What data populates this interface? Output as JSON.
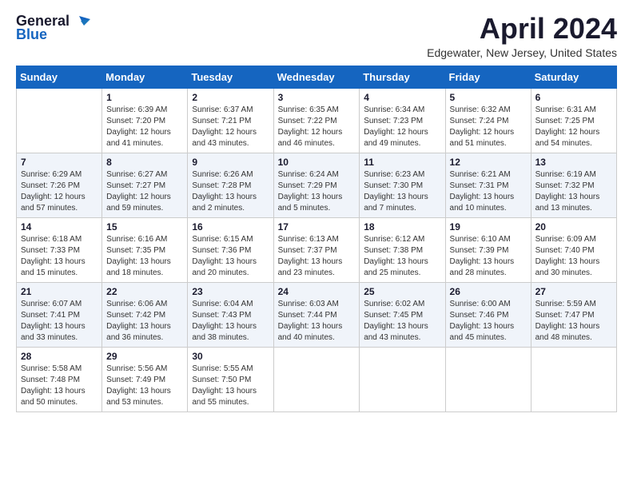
{
  "logo": {
    "general": "General",
    "blue": "Blue"
  },
  "title": "April 2024",
  "location": "Edgewater, New Jersey, United States",
  "days_of_week": [
    "Sunday",
    "Monday",
    "Tuesday",
    "Wednesday",
    "Thursday",
    "Friday",
    "Saturday"
  ],
  "weeks": [
    [
      {
        "day": "",
        "sunrise": "",
        "sunset": "",
        "daylight": ""
      },
      {
        "day": "1",
        "sunrise": "Sunrise: 6:39 AM",
        "sunset": "Sunset: 7:20 PM",
        "daylight": "Daylight: 12 hours and 41 minutes."
      },
      {
        "day": "2",
        "sunrise": "Sunrise: 6:37 AM",
        "sunset": "Sunset: 7:21 PM",
        "daylight": "Daylight: 12 hours and 43 minutes."
      },
      {
        "day": "3",
        "sunrise": "Sunrise: 6:35 AM",
        "sunset": "Sunset: 7:22 PM",
        "daylight": "Daylight: 12 hours and 46 minutes."
      },
      {
        "day": "4",
        "sunrise": "Sunrise: 6:34 AM",
        "sunset": "Sunset: 7:23 PM",
        "daylight": "Daylight: 12 hours and 49 minutes."
      },
      {
        "day": "5",
        "sunrise": "Sunrise: 6:32 AM",
        "sunset": "Sunset: 7:24 PM",
        "daylight": "Daylight: 12 hours and 51 minutes."
      },
      {
        "day": "6",
        "sunrise": "Sunrise: 6:31 AM",
        "sunset": "Sunset: 7:25 PM",
        "daylight": "Daylight: 12 hours and 54 minutes."
      }
    ],
    [
      {
        "day": "7",
        "sunrise": "Sunrise: 6:29 AM",
        "sunset": "Sunset: 7:26 PM",
        "daylight": "Daylight: 12 hours and 57 minutes."
      },
      {
        "day": "8",
        "sunrise": "Sunrise: 6:27 AM",
        "sunset": "Sunset: 7:27 PM",
        "daylight": "Daylight: 12 hours and 59 minutes."
      },
      {
        "day": "9",
        "sunrise": "Sunrise: 6:26 AM",
        "sunset": "Sunset: 7:28 PM",
        "daylight": "Daylight: 13 hours and 2 minutes."
      },
      {
        "day": "10",
        "sunrise": "Sunrise: 6:24 AM",
        "sunset": "Sunset: 7:29 PM",
        "daylight": "Daylight: 13 hours and 5 minutes."
      },
      {
        "day": "11",
        "sunrise": "Sunrise: 6:23 AM",
        "sunset": "Sunset: 7:30 PM",
        "daylight": "Daylight: 13 hours and 7 minutes."
      },
      {
        "day": "12",
        "sunrise": "Sunrise: 6:21 AM",
        "sunset": "Sunset: 7:31 PM",
        "daylight": "Daylight: 13 hours and 10 minutes."
      },
      {
        "day": "13",
        "sunrise": "Sunrise: 6:19 AM",
        "sunset": "Sunset: 7:32 PM",
        "daylight": "Daylight: 13 hours and 13 minutes."
      }
    ],
    [
      {
        "day": "14",
        "sunrise": "Sunrise: 6:18 AM",
        "sunset": "Sunset: 7:33 PM",
        "daylight": "Daylight: 13 hours and 15 minutes."
      },
      {
        "day": "15",
        "sunrise": "Sunrise: 6:16 AM",
        "sunset": "Sunset: 7:35 PM",
        "daylight": "Daylight: 13 hours and 18 minutes."
      },
      {
        "day": "16",
        "sunrise": "Sunrise: 6:15 AM",
        "sunset": "Sunset: 7:36 PM",
        "daylight": "Daylight: 13 hours and 20 minutes."
      },
      {
        "day": "17",
        "sunrise": "Sunrise: 6:13 AM",
        "sunset": "Sunset: 7:37 PM",
        "daylight": "Daylight: 13 hours and 23 minutes."
      },
      {
        "day": "18",
        "sunrise": "Sunrise: 6:12 AM",
        "sunset": "Sunset: 7:38 PM",
        "daylight": "Daylight: 13 hours and 25 minutes."
      },
      {
        "day": "19",
        "sunrise": "Sunrise: 6:10 AM",
        "sunset": "Sunset: 7:39 PM",
        "daylight": "Daylight: 13 hours and 28 minutes."
      },
      {
        "day": "20",
        "sunrise": "Sunrise: 6:09 AM",
        "sunset": "Sunset: 7:40 PM",
        "daylight": "Daylight: 13 hours and 30 minutes."
      }
    ],
    [
      {
        "day": "21",
        "sunrise": "Sunrise: 6:07 AM",
        "sunset": "Sunset: 7:41 PM",
        "daylight": "Daylight: 13 hours and 33 minutes."
      },
      {
        "day": "22",
        "sunrise": "Sunrise: 6:06 AM",
        "sunset": "Sunset: 7:42 PM",
        "daylight": "Daylight: 13 hours and 36 minutes."
      },
      {
        "day": "23",
        "sunrise": "Sunrise: 6:04 AM",
        "sunset": "Sunset: 7:43 PM",
        "daylight": "Daylight: 13 hours and 38 minutes."
      },
      {
        "day": "24",
        "sunrise": "Sunrise: 6:03 AM",
        "sunset": "Sunset: 7:44 PM",
        "daylight": "Daylight: 13 hours and 40 minutes."
      },
      {
        "day": "25",
        "sunrise": "Sunrise: 6:02 AM",
        "sunset": "Sunset: 7:45 PM",
        "daylight": "Daylight: 13 hours and 43 minutes."
      },
      {
        "day": "26",
        "sunrise": "Sunrise: 6:00 AM",
        "sunset": "Sunset: 7:46 PM",
        "daylight": "Daylight: 13 hours and 45 minutes."
      },
      {
        "day": "27",
        "sunrise": "Sunrise: 5:59 AM",
        "sunset": "Sunset: 7:47 PM",
        "daylight": "Daylight: 13 hours and 48 minutes."
      }
    ],
    [
      {
        "day": "28",
        "sunrise": "Sunrise: 5:58 AM",
        "sunset": "Sunset: 7:48 PM",
        "daylight": "Daylight: 13 hours and 50 minutes."
      },
      {
        "day": "29",
        "sunrise": "Sunrise: 5:56 AM",
        "sunset": "Sunset: 7:49 PM",
        "daylight": "Daylight: 13 hours and 53 minutes."
      },
      {
        "day": "30",
        "sunrise": "Sunrise: 5:55 AM",
        "sunset": "Sunset: 7:50 PM",
        "daylight": "Daylight: 13 hours and 55 minutes."
      },
      {
        "day": "",
        "sunrise": "",
        "sunset": "",
        "daylight": ""
      },
      {
        "day": "",
        "sunrise": "",
        "sunset": "",
        "daylight": ""
      },
      {
        "day": "",
        "sunrise": "",
        "sunset": "",
        "daylight": ""
      },
      {
        "day": "",
        "sunrise": "",
        "sunset": "",
        "daylight": ""
      }
    ]
  ]
}
